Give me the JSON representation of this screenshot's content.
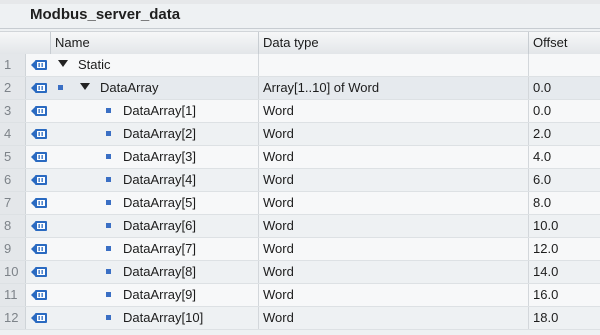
{
  "block_title": "Modbus_server_data",
  "columns": {
    "name": "Name",
    "data_type": "Data type",
    "offset": "Offset"
  },
  "rows": [
    {
      "num": "1",
      "name": "Static",
      "type": "",
      "offset": ""
    },
    {
      "num": "2",
      "name": "DataArray",
      "type": "Array[1..10] of Word",
      "offset": "0.0"
    },
    {
      "num": "3",
      "name": "DataArray[1]",
      "type": "Word",
      "offset": "0.0"
    },
    {
      "num": "4",
      "name": "DataArray[2]",
      "type": "Word",
      "offset": "2.0"
    },
    {
      "num": "5",
      "name": "DataArray[3]",
      "type": "Word",
      "offset": "4.0"
    },
    {
      "num": "6",
      "name": "DataArray[4]",
      "type": "Word",
      "offset": "6.0"
    },
    {
      "num": "7",
      "name": "DataArray[5]",
      "type": "Word",
      "offset": "8.0"
    },
    {
      "num": "8",
      "name": "DataArray[6]",
      "type": "Word",
      "offset": "10.0"
    },
    {
      "num": "9",
      "name": "DataArray[7]",
      "type": "Word",
      "offset": "12.0"
    },
    {
      "num": "10",
      "name": "DataArray[8]",
      "type": "Word",
      "offset": "14.0"
    },
    {
      "num": "11",
      "name": "DataArray[9]",
      "type": "Word",
      "offset": "16.0"
    },
    {
      "num": "12",
      "name": "DataArray[10]",
      "type": "Word",
      "offset": "18.0"
    }
  ],
  "icons": {
    "row_icon": "db-interface-icon",
    "expand": "expand-triangle-icon",
    "element": "element-bullet-icon"
  },
  "colors": {
    "icon_blue": "#2a6ac1",
    "bullet_blue": "#3a6fc4"
  }
}
